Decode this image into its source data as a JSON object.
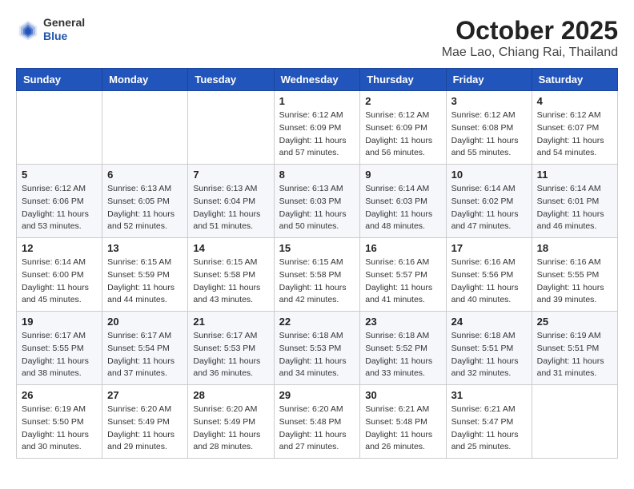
{
  "header": {
    "logo": {
      "line1": "General",
      "line2": "Blue"
    },
    "title": "October 2025",
    "location": "Mae Lao, Chiang Rai, Thailand"
  },
  "columns": [
    "Sunday",
    "Monday",
    "Tuesday",
    "Wednesday",
    "Thursday",
    "Friday",
    "Saturday"
  ],
  "weeks": [
    [
      {
        "day": "",
        "info": ""
      },
      {
        "day": "",
        "info": ""
      },
      {
        "day": "",
        "info": ""
      },
      {
        "day": "1",
        "info": "Sunrise: 6:12 AM\nSunset: 6:09 PM\nDaylight: 11 hours\nand 57 minutes."
      },
      {
        "day": "2",
        "info": "Sunrise: 6:12 AM\nSunset: 6:09 PM\nDaylight: 11 hours\nand 56 minutes."
      },
      {
        "day": "3",
        "info": "Sunrise: 6:12 AM\nSunset: 6:08 PM\nDaylight: 11 hours\nand 55 minutes."
      },
      {
        "day": "4",
        "info": "Sunrise: 6:12 AM\nSunset: 6:07 PM\nDaylight: 11 hours\nand 54 minutes."
      }
    ],
    [
      {
        "day": "5",
        "info": "Sunrise: 6:12 AM\nSunset: 6:06 PM\nDaylight: 11 hours\nand 53 minutes."
      },
      {
        "day": "6",
        "info": "Sunrise: 6:13 AM\nSunset: 6:05 PM\nDaylight: 11 hours\nand 52 minutes."
      },
      {
        "day": "7",
        "info": "Sunrise: 6:13 AM\nSunset: 6:04 PM\nDaylight: 11 hours\nand 51 minutes."
      },
      {
        "day": "8",
        "info": "Sunrise: 6:13 AM\nSunset: 6:03 PM\nDaylight: 11 hours\nand 50 minutes."
      },
      {
        "day": "9",
        "info": "Sunrise: 6:14 AM\nSunset: 6:03 PM\nDaylight: 11 hours\nand 48 minutes."
      },
      {
        "day": "10",
        "info": "Sunrise: 6:14 AM\nSunset: 6:02 PM\nDaylight: 11 hours\nand 47 minutes."
      },
      {
        "day": "11",
        "info": "Sunrise: 6:14 AM\nSunset: 6:01 PM\nDaylight: 11 hours\nand 46 minutes."
      }
    ],
    [
      {
        "day": "12",
        "info": "Sunrise: 6:14 AM\nSunset: 6:00 PM\nDaylight: 11 hours\nand 45 minutes."
      },
      {
        "day": "13",
        "info": "Sunrise: 6:15 AM\nSunset: 5:59 PM\nDaylight: 11 hours\nand 44 minutes."
      },
      {
        "day": "14",
        "info": "Sunrise: 6:15 AM\nSunset: 5:58 PM\nDaylight: 11 hours\nand 43 minutes."
      },
      {
        "day": "15",
        "info": "Sunrise: 6:15 AM\nSunset: 5:58 PM\nDaylight: 11 hours\nand 42 minutes."
      },
      {
        "day": "16",
        "info": "Sunrise: 6:16 AM\nSunset: 5:57 PM\nDaylight: 11 hours\nand 41 minutes."
      },
      {
        "day": "17",
        "info": "Sunrise: 6:16 AM\nSunset: 5:56 PM\nDaylight: 11 hours\nand 40 minutes."
      },
      {
        "day": "18",
        "info": "Sunrise: 6:16 AM\nSunset: 5:55 PM\nDaylight: 11 hours\nand 39 minutes."
      }
    ],
    [
      {
        "day": "19",
        "info": "Sunrise: 6:17 AM\nSunset: 5:55 PM\nDaylight: 11 hours\nand 38 minutes."
      },
      {
        "day": "20",
        "info": "Sunrise: 6:17 AM\nSunset: 5:54 PM\nDaylight: 11 hours\nand 37 minutes."
      },
      {
        "day": "21",
        "info": "Sunrise: 6:17 AM\nSunset: 5:53 PM\nDaylight: 11 hours\nand 36 minutes."
      },
      {
        "day": "22",
        "info": "Sunrise: 6:18 AM\nSunset: 5:53 PM\nDaylight: 11 hours\nand 34 minutes."
      },
      {
        "day": "23",
        "info": "Sunrise: 6:18 AM\nSunset: 5:52 PM\nDaylight: 11 hours\nand 33 minutes."
      },
      {
        "day": "24",
        "info": "Sunrise: 6:18 AM\nSunset: 5:51 PM\nDaylight: 11 hours\nand 32 minutes."
      },
      {
        "day": "25",
        "info": "Sunrise: 6:19 AM\nSunset: 5:51 PM\nDaylight: 11 hours\nand 31 minutes."
      }
    ],
    [
      {
        "day": "26",
        "info": "Sunrise: 6:19 AM\nSunset: 5:50 PM\nDaylight: 11 hours\nand 30 minutes."
      },
      {
        "day": "27",
        "info": "Sunrise: 6:20 AM\nSunset: 5:49 PM\nDaylight: 11 hours\nand 29 minutes."
      },
      {
        "day": "28",
        "info": "Sunrise: 6:20 AM\nSunset: 5:49 PM\nDaylight: 11 hours\nand 28 minutes."
      },
      {
        "day": "29",
        "info": "Sunrise: 6:20 AM\nSunset: 5:48 PM\nDaylight: 11 hours\nand 27 minutes."
      },
      {
        "day": "30",
        "info": "Sunrise: 6:21 AM\nSunset: 5:48 PM\nDaylight: 11 hours\nand 26 minutes."
      },
      {
        "day": "31",
        "info": "Sunrise: 6:21 AM\nSunset: 5:47 PM\nDaylight: 11 hours\nand 25 minutes."
      },
      {
        "day": "",
        "info": ""
      }
    ]
  ]
}
